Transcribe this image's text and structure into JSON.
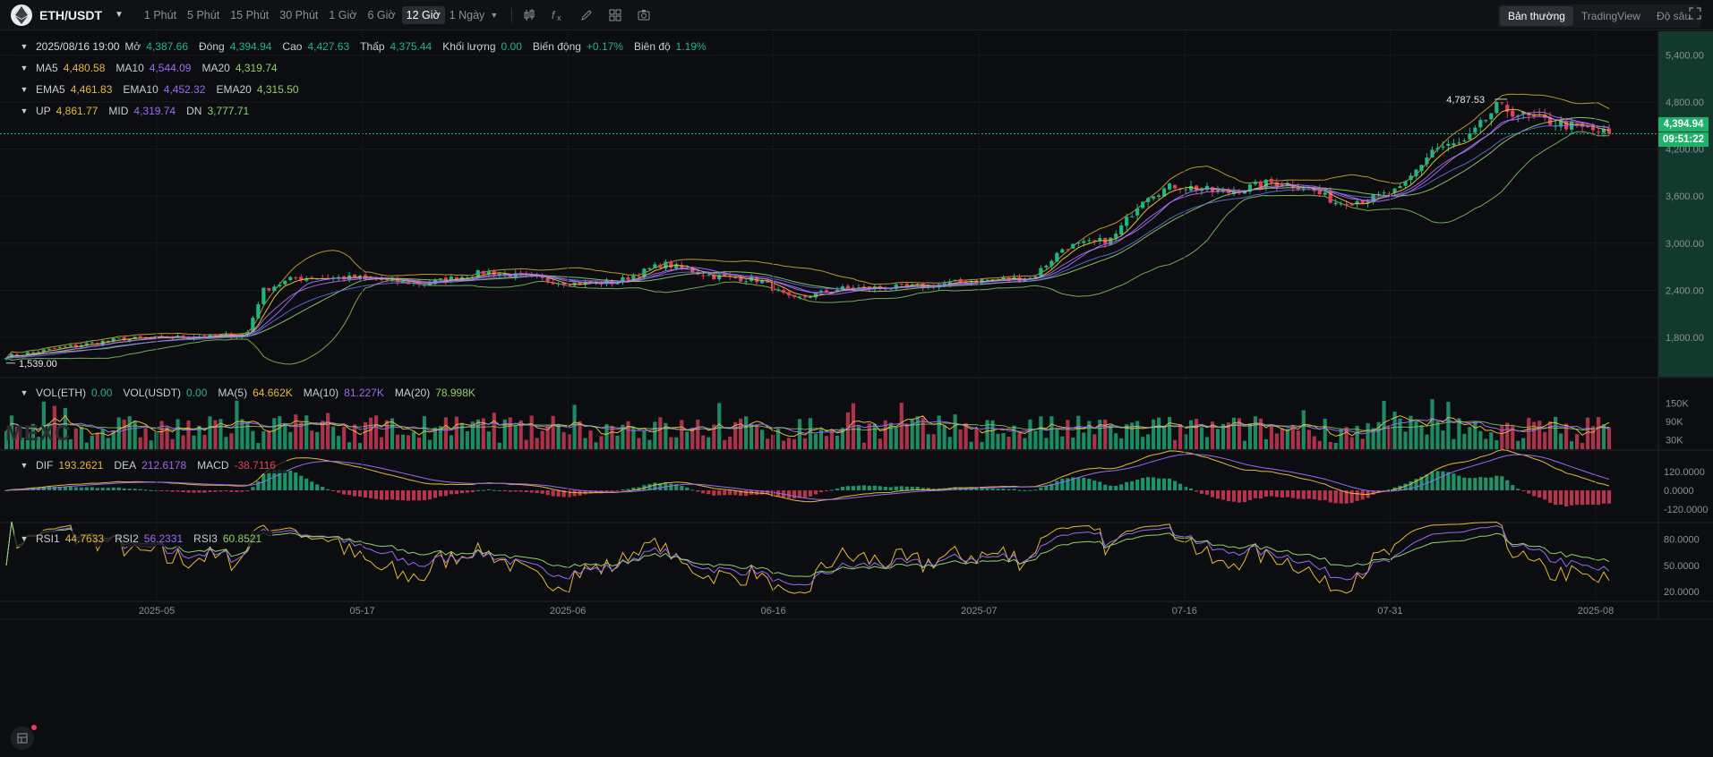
{
  "toolbar": {
    "symbol": "ETH/USDT",
    "intervals": [
      "1 Phút",
      "5 Phút",
      "15 Phút",
      "30 Phút",
      "1 Giờ",
      "6 Giờ",
      "12 Giờ"
    ],
    "active_interval": "12 Giờ",
    "more_interval": "1 Ngày",
    "view_modes": [
      "Bản thường",
      "TradingView",
      "Độ sâu"
    ],
    "active_view": "Bản thường",
    "icons": [
      "candle-type-icon",
      "indicator-fx-icon",
      "draw-pencil-icon",
      "layout-grid-icon",
      "camera-icon",
      "fullscreen-icon"
    ]
  },
  "ohlc": {
    "date": "2025/08/16 19:00",
    "open_label": "Mở",
    "open": "4,387.66",
    "close_label": "Đóng",
    "close": "4,394.94",
    "high_label": "Cao",
    "high": "4,427.63",
    "low_label": "Thấp",
    "low": "4,375.44",
    "vol_label": "Khối lượng",
    "vol": "0.00",
    "change_label": "Biến động",
    "change": "+0.17%",
    "amp_label": "Biên độ",
    "amp": "1.19%"
  },
  "ma": {
    "ma5_label": "MA5",
    "ma5": "4,480.58",
    "ma10_label": "MA10",
    "ma10": "4,544.09",
    "ma20_label": "MA20",
    "ma20": "4,319.74"
  },
  "ema": {
    "ema5_label": "EMA5",
    "ema5": "4,461.83",
    "ema10_label": "EMA10",
    "ema10": "4,452.32",
    "ema20_label": "EMA20",
    "ema20": "4,315.50"
  },
  "boll": {
    "up_label": "UP",
    "up": "4,861.77",
    "mid_label": "MID",
    "mid": "4,319.74",
    "dn_label": "DN",
    "dn": "3,777.71"
  },
  "vol": {
    "eth_label": "VOL(ETH)",
    "eth": "0.00",
    "usdt_label": "VOL(USDT)",
    "usdt": "0.00",
    "ma5_label": "MA(5)",
    "ma5": "64.662K",
    "ma10_label": "MA(10)",
    "ma10": "81.227K",
    "ma20_label": "MA(20)",
    "ma20": "78.998K"
  },
  "macd": {
    "dif_label": "DIF",
    "dif": "193.2621",
    "dea_label": "DEA",
    "dea": "212.6178",
    "macd_label": "MACD",
    "macd": "-38.7116"
  },
  "rsi": {
    "rsi1_label": "RSI1",
    "rsi1": "44.7633",
    "rsi2_label": "RSI2",
    "rsi2": "56.2331",
    "rsi3_label": "RSI3",
    "rsi3": "60.8521"
  },
  "price_tag": {
    "price": "4,394.94",
    "countdown": "09:51:22"
  },
  "watermark": "MEXC",
  "colors": {
    "up": "#24b47e",
    "down": "#e0405c",
    "ma5": "#e8b73a",
    "ma10": "#9b6bf2",
    "ma20": "#8fd16a",
    "bg": "#0c0d10"
  },
  "chart_data": {
    "type": "candlestick",
    "interval": "12 Giờ",
    "price_axis": {
      "ticks": [
        "5,400.00",
        "4,800.00",
        "4,200.00",
        "3,600.00",
        "3,000.00",
        "2,400.00",
        "1,800.00"
      ],
      "range": [
        1300,
        5700
      ]
    },
    "time_axis": {
      "ticks": [
        "2025-05",
        "05-17",
        "2025-06",
        "06-16",
        "2025-07",
        "07-16",
        "07-31",
        "2025-08"
      ]
    },
    "annotations": {
      "high": "4,787.53",
      "low": "1,539.00"
    },
    "anchors": [
      {
        "t": 0,
        "p": 1560
      },
      {
        "t": 0.07,
        "p": 1780
      },
      {
        "t": 0.13,
        "p": 1820
      },
      {
        "t": 0.15,
        "p": 1840
      },
      {
        "t": 0.16,
        "p": 2400
      },
      {
        "t": 0.18,
        "p": 2560
      },
      {
        "t": 0.22,
        "p": 2560
      },
      {
        "t": 0.26,
        "p": 2480
      },
      {
        "t": 0.3,
        "p": 2640
      },
      {
        "t": 0.35,
        "p": 2490
      },
      {
        "t": 0.38,
        "p": 2500
      },
      {
        "t": 0.41,
        "p": 2740
      },
      {
        "t": 0.44,
        "p": 2580
      },
      {
        "t": 0.47,
        "p": 2530
      },
      {
        "t": 0.49,
        "p": 2280
      },
      {
        "t": 0.52,
        "p": 2420
      },
      {
        "t": 0.57,
        "p": 2450
      },
      {
        "t": 0.6,
        "p": 2520
      },
      {
        "t": 0.64,
        "p": 2560
      },
      {
        "t": 0.66,
        "p": 2950
      },
      {
        "t": 0.69,
        "p": 3050
      },
      {
        "t": 0.71,
        "p": 3600
      },
      {
        "t": 0.73,
        "p": 3740
      },
      {
        "t": 0.76,
        "p": 3640
      },
      {
        "t": 0.79,
        "p": 3780
      },
      {
        "t": 0.81,
        "p": 3720
      },
      {
        "t": 0.83,
        "p": 3520
      },
      {
        "t": 0.85,
        "p": 3560
      },
      {
        "t": 0.87,
        "p": 3680
      },
      {
        "t": 0.89,
        "p": 4200
      },
      {
        "t": 0.91,
        "p": 4280
      },
      {
        "t": 0.93,
        "p": 4740
      },
      {
        "t": 0.95,
        "p": 4600
      },
      {
        "t": 1,
        "p": 4395
      }
    ],
    "volume_axis": {
      "ticks": [
        "150K",
        "90K",
        "30K"
      ],
      "range": [
        0,
        200000
      ]
    },
    "macd_axis": {
      "ticks": [
        "120.0000",
        "0.0000",
        "-120.0000"
      ],
      "range": [
        -200,
        240
      ]
    },
    "rsi_axis": {
      "ticks": [
        "80.0000",
        "50.0000",
        "20.0000"
      ],
      "range": [
        10,
        95
      ]
    }
  }
}
